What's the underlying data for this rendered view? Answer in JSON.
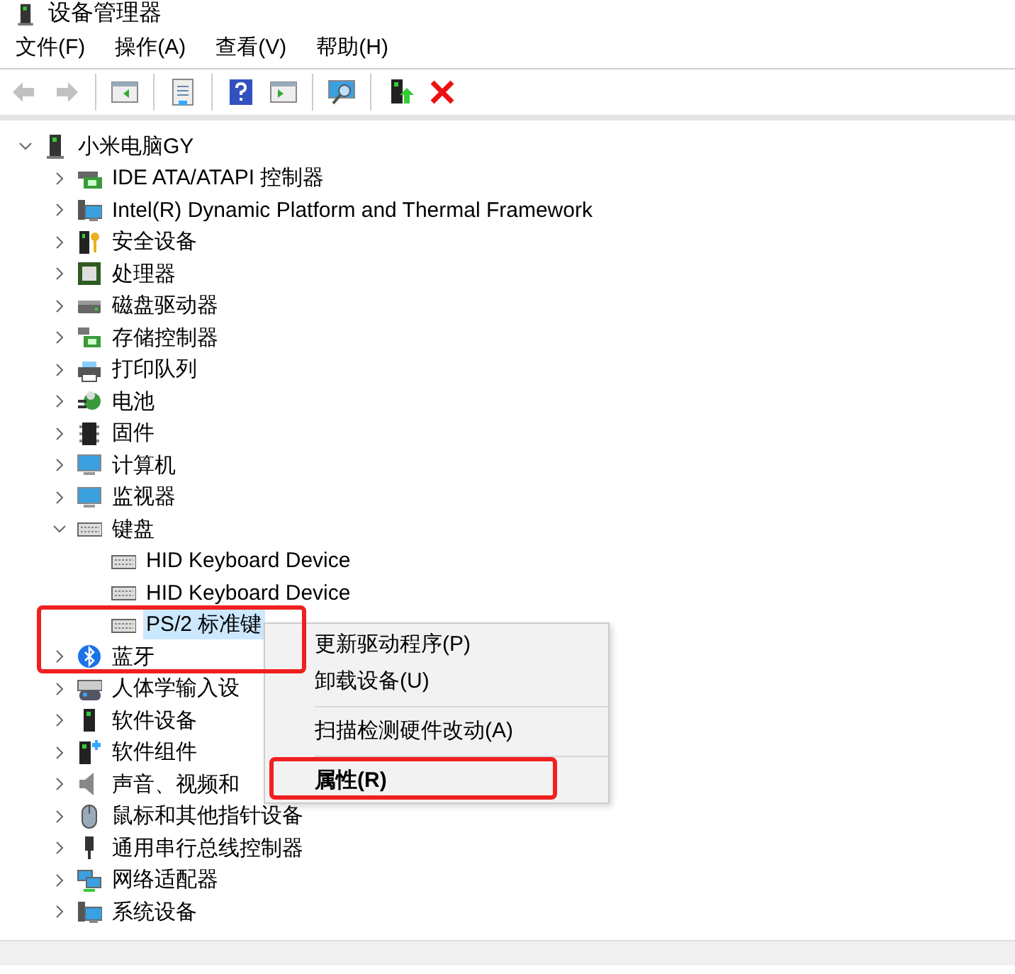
{
  "window": {
    "title": "设备管理器"
  },
  "menu_bar": [
    {
      "label": "文件(F)"
    },
    {
      "label": "操作(A)"
    },
    {
      "label": "查看(V)"
    },
    {
      "label": "帮助(H)"
    }
  ],
  "toolbar": [
    {
      "kind": "button",
      "enabled": false
    },
    {
      "kind": "button",
      "enabled": false
    },
    {
      "kind": "separator"
    },
    {
      "kind": "button",
      "enabled": true
    },
    {
      "kind": "separator"
    },
    {
      "kind": "button",
      "enabled": true
    },
    {
      "kind": "separator"
    },
    {
      "kind": "button",
      "enabled": true
    },
    {
      "kind": "button",
      "enabled": true
    },
    {
      "kind": "separator"
    },
    {
      "kind": "button",
      "enabled": true
    },
    {
      "kind": "separator"
    },
    {
      "kind": "button",
      "enabled": true
    },
    {
      "kind": "button",
      "enabled": true
    }
  ],
  "tree": [
    {
      "label": "小米电脑GY",
      "expanded": true,
      "selected": false,
      "children": [
        {
          "label": "IDE ATA/ATAPI 控制器",
          "expanded": false,
          "selected": false
        },
        {
          "label": "Intel(R) Dynamic Platform and Thermal Framework",
          "expanded": false,
          "selected": false
        },
        {
          "label": "安全设备",
          "expanded": false,
          "selected": false
        },
        {
          "label": "处理器",
          "expanded": false,
          "selected": false
        },
        {
          "label": "磁盘驱动器",
          "expanded": false,
          "selected": false
        },
        {
          "label": "存储控制器",
          "expanded": false,
          "selected": false
        },
        {
          "label": "打印队列",
          "expanded": false,
          "selected": false
        },
        {
          "label": "电池",
          "expanded": false,
          "selected": false
        },
        {
          "label": "固件",
          "expanded": false,
          "selected": false
        },
        {
          "label": "计算机",
          "expanded": false,
          "selected": false
        },
        {
          "label": "监视器",
          "expanded": false,
          "selected": false
        },
        {
          "label": "键盘",
          "expanded": true,
          "selected": false,
          "children": [
            {
              "label": "HID Keyboard Device",
              "selected": false
            },
            {
              "label": "HID Keyboard Device",
              "selected": false
            },
            {
              "label": "PS/2 标准键",
              "selected": true
            }
          ]
        },
        {
          "label": "蓝牙",
          "expanded": false,
          "selected": false
        },
        {
          "label": "人体学输入设",
          "expanded": false,
          "selected": false
        },
        {
          "label": "软件设备",
          "expanded": false,
          "selected": false
        },
        {
          "label": "软件组件",
          "expanded": false,
          "selected": false
        },
        {
          "label": "声音、视频和",
          "expanded": false,
          "selected": false
        },
        {
          "label": "鼠标和其他指针设备",
          "expanded": false,
          "selected": false
        },
        {
          "label": "通用串行总线控制器",
          "expanded": false,
          "selected": false
        },
        {
          "label": "网络适配器",
          "expanded": false,
          "selected": false
        },
        {
          "label": "系统设备",
          "expanded": false,
          "selected": false
        }
      ]
    }
  ],
  "context_menu": [
    {
      "kind": "item",
      "label": "更新驱动程序(P)",
      "default": false
    },
    {
      "kind": "item",
      "label": "卸载设备(U)",
      "default": false
    },
    {
      "kind": "separator"
    },
    {
      "kind": "item",
      "label": "扫描检测硬件改动(A)",
      "default": false
    },
    {
      "kind": "separator"
    },
    {
      "kind": "item",
      "label": "属性(R)",
      "default": true
    }
  ]
}
